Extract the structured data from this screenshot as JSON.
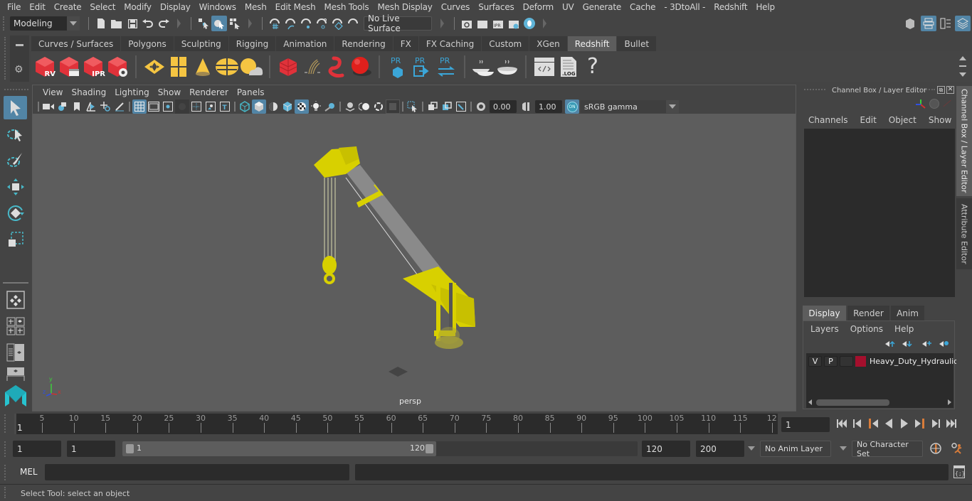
{
  "menubar": [
    "File",
    "Edit",
    "Create",
    "Select",
    "Modify",
    "Display",
    "Windows",
    "Mesh",
    "Edit Mesh",
    "Mesh Tools",
    "Mesh Display",
    "Curves",
    "Surfaces",
    "Deform",
    "UV",
    "Generate",
    "Cache",
    "- 3DtoAll -",
    "Redshift",
    "Help"
  ],
  "statusline": {
    "mode": "Modeling",
    "live_surface": "No Live Surface"
  },
  "shelf": {
    "tabs": [
      "Curves / Surfaces",
      "Polygons",
      "Sculpting",
      "Rigging",
      "Animation",
      "Rendering",
      "FX",
      "FX Caching",
      "Custom",
      "XGen",
      "Redshift",
      "Bullet"
    ],
    "active_tab": "Redshift",
    "icon_labels": {
      "rv": "RV",
      "ipr": "IPR",
      "pr": "PR",
      "log": ".LOG",
      "help": "?"
    }
  },
  "viewport": {
    "menu": [
      "View",
      "Shading",
      "Lighting",
      "Show",
      "Renderer",
      "Panels"
    ],
    "exposure": "0.00",
    "gamma": "1.00",
    "color_toggle": "ON",
    "color_space": "sRGB gamma",
    "camera_label": "persp",
    "axis": {
      "x": "x",
      "y": "y",
      "z": "z"
    },
    "model_color": "#d8d000"
  },
  "channel_box": {
    "title": "Channel Box / Layer Editor",
    "menu": [
      "Channels",
      "Edit",
      "Object",
      "Show"
    ]
  },
  "layer_editor": {
    "tabs": [
      "Display",
      "Render",
      "Anim"
    ],
    "active_tab": "Display",
    "menu": [
      "Layers",
      "Options",
      "Help"
    ],
    "layers": [
      {
        "v": "V",
        "p": "P",
        "color": "#a50f2d",
        "name": "Heavy_Duty_Hydraulic_"
      }
    ]
  },
  "side_tabs": [
    "Channel Box / Layer Editor",
    "Attribute Editor"
  ],
  "timeline": {
    "start_label": "1",
    "ticks": [
      "5",
      "10",
      "15",
      "20",
      "25",
      "30",
      "35",
      "40",
      "45",
      "50",
      "55",
      "60",
      "65",
      "70",
      "75",
      "80",
      "85",
      "90",
      "95",
      "100",
      "105",
      "110",
      "115",
      "12"
    ],
    "current_frame": "1"
  },
  "range": {
    "start": "1",
    "playback_start": "1",
    "slider_min": "1",
    "slider_max": "120",
    "playback_end": "120",
    "end": "200",
    "anim_layer": "No Anim Layer",
    "character_set": "No Character Set"
  },
  "command_line": {
    "language": "MEL"
  },
  "help_line": "Select Tool: select an object"
}
